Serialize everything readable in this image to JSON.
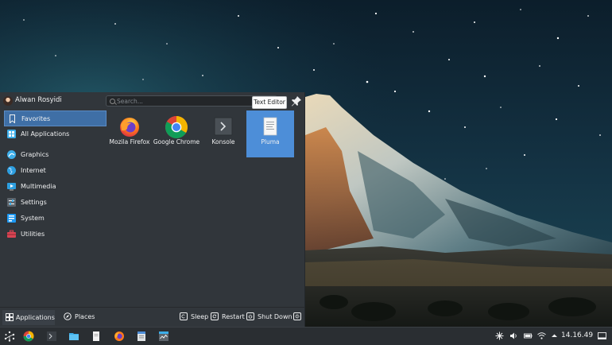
{
  "user": {
    "name": "Alwan Rosyidi"
  },
  "search": {
    "placeholder": "Search..."
  },
  "tooltip": {
    "text": "Text Editor"
  },
  "categories": [
    {
      "label": "Favorites",
      "icon": "bookmark-icon",
      "active": true
    },
    {
      "label": "All Applications",
      "icon": "grid-icon"
    },
    {
      "label": "Graphics",
      "icon": "graphics-icon"
    },
    {
      "label": "Internet",
      "icon": "globe-icon"
    },
    {
      "label": "Multimedia",
      "icon": "multimedia-icon"
    },
    {
      "label": "Settings",
      "icon": "settings-icon"
    },
    {
      "label": "System",
      "icon": "system-icon"
    },
    {
      "label": "Utilities",
      "icon": "toolbox-icon"
    }
  ],
  "favorites": [
    {
      "label": "Mozila Firefox",
      "icon": "firefox-icon"
    },
    {
      "label": "Google Chrome",
      "icon": "chrome-icon"
    },
    {
      "label": "Konsole",
      "icon": "terminal-icon"
    },
    {
      "label": "Pluma",
      "icon": "text-editor-icon",
      "selected": true
    }
  ],
  "footer": {
    "tabs": [
      {
        "label": "Applications"
      },
      {
        "label": "Places"
      }
    ],
    "actions": [
      {
        "label": "Sleep"
      },
      {
        "label": "Restart"
      },
      {
        "label": "Shut Down"
      }
    ]
  },
  "taskbar": {
    "items": [
      "application-launcher-icon",
      "chrome-icon",
      "terminal-icon",
      "file-manager-icon",
      "document-icon",
      "firefox-icon",
      "text-editor-icon",
      "system-monitor-icon"
    ],
    "tray": [
      "network-share-icon",
      "volume-icon",
      "battery-icon",
      "wifi-icon",
      "expand-tray-icon"
    ],
    "clock": "14.16.49"
  },
  "colors": {
    "panel": "#31363b",
    "accent": "#3f6fa6",
    "selected_tile": "#4d8ed8",
    "taskbar": "#2a2e32"
  }
}
